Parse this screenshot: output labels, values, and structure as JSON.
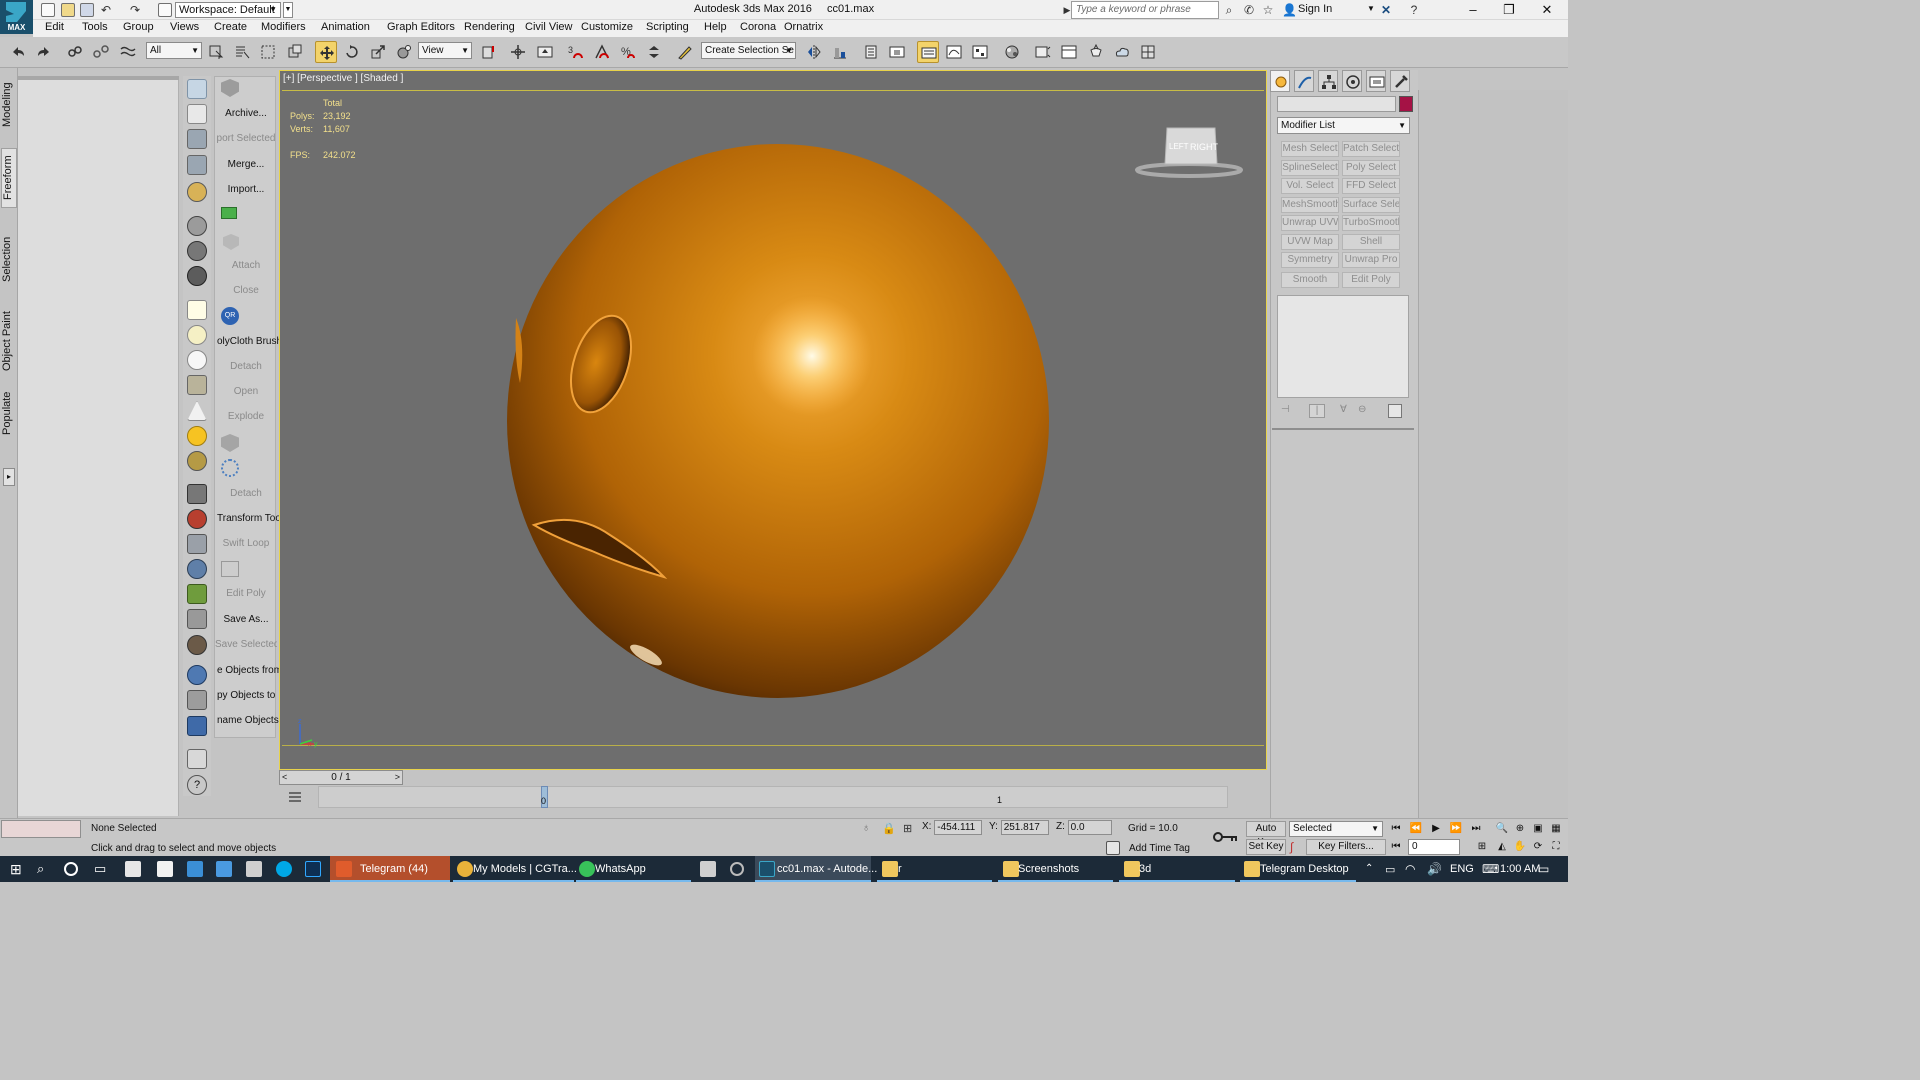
{
  "titlebar": {
    "workspace_label": "Workspace: Default",
    "app_name": "Autodesk 3ds Max 2016",
    "file_name": "cc01.max",
    "search_placeholder": "Type a keyword or phrase",
    "signin_label": "Sign In",
    "logo_text": "MAX"
  },
  "menubar": {
    "items": [
      "Edit",
      "Tools",
      "Group",
      "Views",
      "Create",
      "Modifiers",
      "Animation",
      "Graph Editors",
      "Rendering",
      "Civil View",
      "Customize",
      "Scripting",
      "Help",
      "Corona",
      "Ornatrix"
    ]
  },
  "toolbar": {
    "selection_filter": "All",
    "reference_coord": "View",
    "named_selection_placeholder": "Create Selection Se"
  },
  "ribbon_tabs": [
    "Modeling",
    "Freeform",
    "Selection",
    "Object Paint",
    "Populate"
  ],
  "command_list": [
    {
      "label": "Archive...",
      "enabled": true
    },
    {
      "label": "port Selected",
      "enabled": false
    },
    {
      "label": "Merge...",
      "enabled": true
    },
    {
      "label": "Import...",
      "enabled": true
    },
    {
      "label": "Attach",
      "enabled": false
    },
    {
      "label": "Close",
      "enabled": false
    },
    {
      "label": "olyCloth Brush",
      "enabled": true
    },
    {
      "label": "Detach",
      "enabled": false
    },
    {
      "label": "Open",
      "enabled": false
    },
    {
      "label": "Explode",
      "enabled": false
    },
    {
      "label": "Detach",
      "enabled": false
    },
    {
      "label": "Transform Tool",
      "enabled": true
    },
    {
      "label": "Swift Loop",
      "enabled": false
    },
    {
      "label": "Edit Poly",
      "enabled": false
    },
    {
      "label": "Save As...",
      "enabled": true
    },
    {
      "label": "Save Selected",
      "enabled": false
    },
    {
      "label": "e Objects from",
      "enabled": true
    },
    {
      "label": "py Objects to",
      "enabled": true
    },
    {
      "label": "name Objects",
      "enabled": true
    }
  ],
  "viewport": {
    "label": "[+] [Perspective ] [Shaded ]",
    "stats": {
      "total_label": "Total",
      "polys_label": "Polys:",
      "polys_value": "23,192",
      "verts_label": "Verts:",
      "verts_value": "11,607",
      "fps_label": "FPS:",
      "fps_value": "242.072"
    },
    "viewcube_left": "LEFT",
    "viewcube_right": "RIGHT",
    "axis": {
      "z": "z",
      "x": "x",
      "y": "y"
    },
    "sphere_color": "#c8780a"
  },
  "timeline": {
    "frame_display": "0 / 1",
    "prev_arrow": "<",
    "next_arrow": ">",
    "frame0": "0",
    "frame1": "1"
  },
  "command_panel": {
    "modifier_list_label": "Modifier List",
    "object_color": "#a51245",
    "modifier_buttons": [
      "Mesh Select",
      "Patch Select",
      "SplineSelect",
      "Poly Select",
      "Vol. Select",
      "FFD Select",
      "MeshSmooth",
      "Surface Select",
      "Unwrap UVW",
      "TurboSmooth",
      "UVW Map",
      "Shell",
      "Symmetry",
      "Unwrap Pro",
      "Smooth",
      "Edit Poly"
    ]
  },
  "statusbar": {
    "selection_status": "None Selected",
    "prompt": "Click and drag to select and move objects",
    "x_label": "X:",
    "x_value": "-454.111",
    "y_label": "Y:",
    "y_value": "251.817",
    "z_label": "Z:",
    "z_value": "0.0",
    "grid": "Grid = 10.0",
    "add_time_tag": "Add Time Tag",
    "auto_key": "Auto Key",
    "set_key": "Set Key",
    "key_mode": "Selected",
    "key_filters": "Key Filters...",
    "current_frame": "0"
  },
  "taskbar": {
    "items": [
      {
        "label": "Telegram (44)"
      },
      {
        "label": "My Models | CGTra..."
      },
      {
        "label": "WhatsApp"
      },
      {
        "label": "cc01.max - Autode..."
      },
      {
        "label": "r"
      },
      {
        "label": "Screenshots"
      },
      {
        "label": "3d"
      },
      {
        "label": "Telegram Desktop"
      }
    ],
    "language": "ENG",
    "clock": "1:00 AM"
  }
}
